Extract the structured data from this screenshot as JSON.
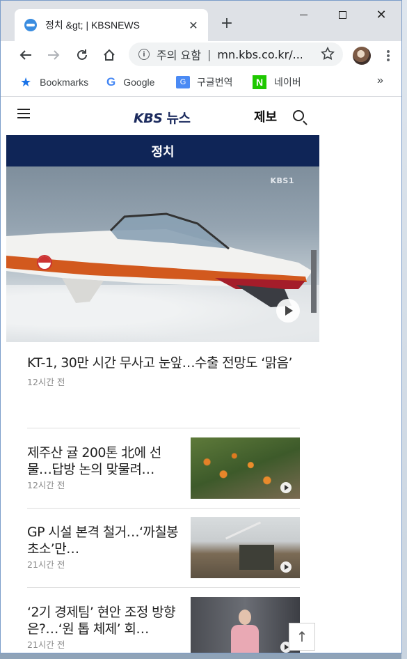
{
  "browser": {
    "tab_title": "정치 &gt; | KBSNEWS",
    "tab_close": "✕",
    "new_tab": "+",
    "window_close": "✕",
    "omnibox_info": "i",
    "omnibox_warning": "주의 요함",
    "omnibox_separator": "|",
    "url": "mn.kbs.co.kr/...",
    "bookmarks": [
      {
        "label": "Bookmarks",
        "icon": "star-icon"
      },
      {
        "label": "Google",
        "icon": "google-icon"
      },
      {
        "label": "구글번역",
        "icon": "translate-icon"
      },
      {
        "label": "네이버",
        "icon": "naver-icon"
      }
    ],
    "bookmarks_more": "»",
    "translate_glyph": "G",
    "naver_glyph": "N",
    "google_glyph": "G",
    "accent": "#1a73e8"
  },
  "site": {
    "logo_kbs": "KBS",
    "logo_news": "뉴스",
    "report_label": "제보",
    "section_title": "정치",
    "brand_color": "#0f2557"
  },
  "lead": {
    "image_tag": "KBS1",
    "title": "KT-1, 30만 시간 무사고 눈앞…수출 전망도 ‘맑음’",
    "time": "12시간 전"
  },
  "articles": [
    {
      "title": "제주산 귤 200톤 北에 선물…답방 논의 맞물려…",
      "time": "12시간 전"
    },
    {
      "title": "GP 시설 본격 철거…‘까칠봉 초소’만…",
      "time": "21시간 전"
    },
    {
      "title": "‘2기 경제팀’ 현안 조정 방향은?…‘원 톱 체제’ 회…",
      "time": "21시간 전"
    }
  ],
  "scroll_top_glyph": "↑"
}
